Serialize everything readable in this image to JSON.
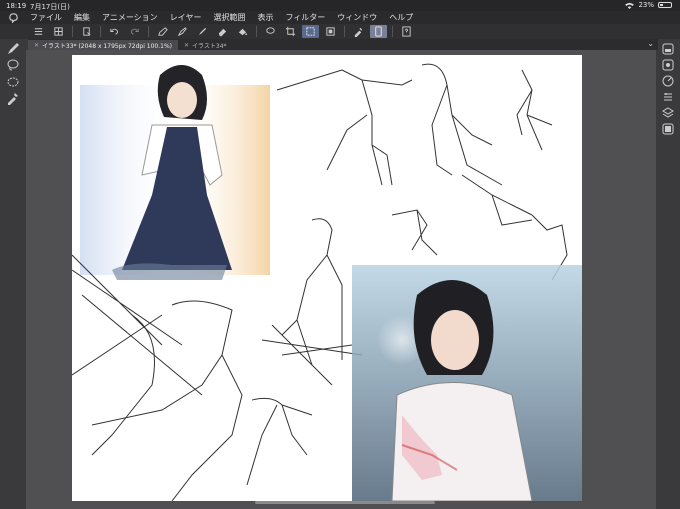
{
  "status": {
    "time": "18:19",
    "date": "7月17日(日)",
    "battery": "23%",
    "battery_level": 0.23
  },
  "menu": {
    "items": [
      "ファイル",
      "編集",
      "アニメーション",
      "レイヤー",
      "選択範囲",
      "表示",
      "フィルター",
      "ウィンドウ",
      "ヘルプ"
    ]
  },
  "toolbar": {
    "icons": [
      "menu-icon",
      "layers-grid-icon",
      "new-canvas-icon",
      "undo-icon",
      "redo-icon",
      "pen-icon",
      "pen-alt-icon",
      "marker-icon",
      "eraser-icon",
      "fill-icon",
      "lasso-icon",
      "crop-icon",
      "selection-box-icon",
      "selection-alt-icon",
      "eyedropper-icon",
      "device-icon",
      "help-icon"
    ]
  },
  "tabs": [
    {
      "label": "イラスト33* (2048 x 1795px 72dpi 100.1%)",
      "active": true
    },
    {
      "label": "イラスト34*",
      "active": false
    }
  ],
  "colors": {
    "accent": "#5a6a8e",
    "panel": "#3a3a3c",
    "canvas_bg": "#505053"
  }
}
